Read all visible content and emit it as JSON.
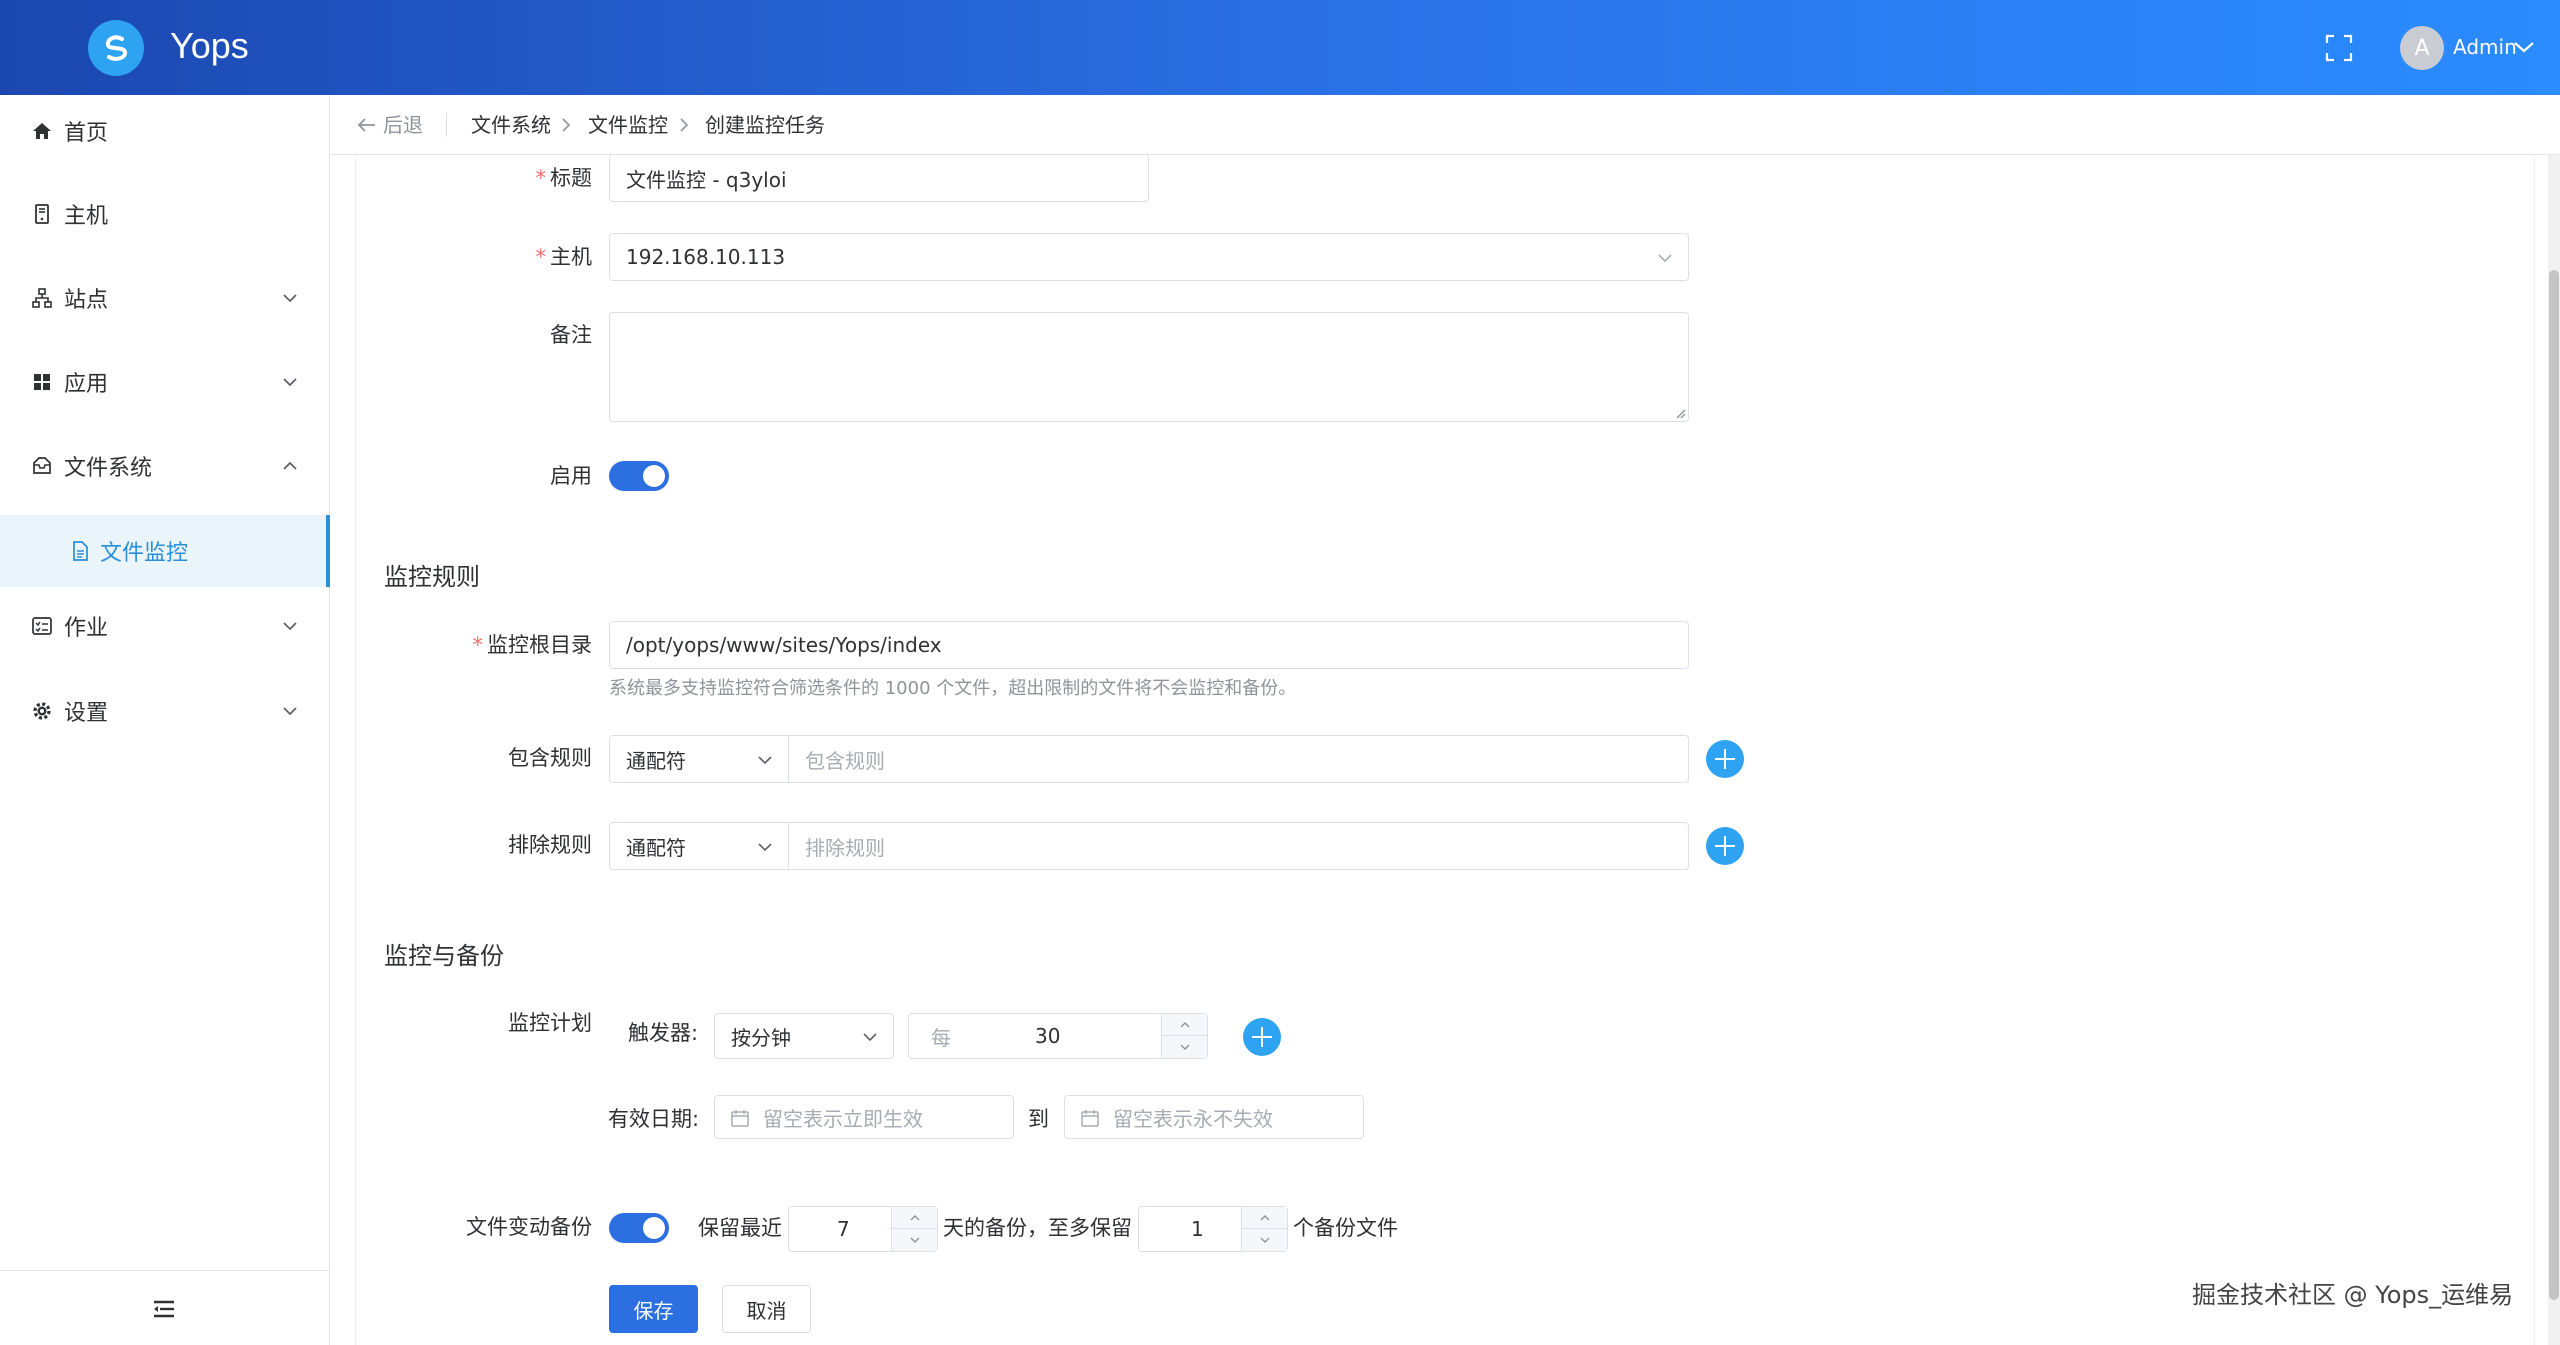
{
  "app": {
    "title": "Yops"
  },
  "header": {
    "username": "Admin",
    "avatar_letter": "A"
  },
  "sidebar": {
    "items": [
      {
        "label": "首页",
        "icon": "home-icon"
      },
      {
        "label": "主机",
        "icon": "server-icon"
      },
      {
        "label": "站点",
        "icon": "sitemap-icon"
      },
      {
        "label": "应用",
        "icon": "apps-icon"
      },
      {
        "label": "文件系统",
        "icon": "folder-lock-icon"
      },
      {
        "label": "文件监控",
        "icon": "file-icon"
      },
      {
        "label": "作业",
        "icon": "task-list-icon"
      },
      {
        "label": "设置",
        "icon": "gear-icon"
      }
    ]
  },
  "breadcrumb": {
    "back": "后退",
    "items": [
      "文件系统",
      "文件监控",
      "创建监控任务"
    ]
  },
  "form": {
    "title_label": "标题",
    "title_value": "文件监控 - q3yloi",
    "host_label": "主机",
    "host_value": "192.168.10.113",
    "remark_label": "备注",
    "enable_label": "启用",
    "rules_section": "监控规则",
    "root_label": "监控根目录",
    "root_value": "/opt/yops/www/sites/Yops/index",
    "root_hint": "系统最多支持监控符合筛选条件的 1000 个文件，超出限制的文件将不会监控和备份。",
    "include_label": "包含规则",
    "include_type": "通配符",
    "include_placeholder": "包含规则",
    "exclude_label": "排除规则",
    "exclude_type": "通配符",
    "exclude_placeholder": "排除规则",
    "backup_section": "监控与备份",
    "schedule_label": "监控计划",
    "trigger_label": "触发器:",
    "trigger_value": "按分钟",
    "every_prefix": "每",
    "every_value": "30",
    "valid_label": "有效日期:",
    "start_placeholder": "留空表示立即生效",
    "to_label": "到",
    "end_placeholder": "留空表示永不失效",
    "backup_label": "文件变动备份",
    "keep_recent_prefix": "保留最近",
    "keep_days": "7",
    "days_suffix": "天的备份，至多保留",
    "keep_count": "1",
    "count_suffix": "个备份文件",
    "save_button": "保存",
    "cancel_button": "取消"
  },
  "watermark": "掘金技术社区 @ Yops_运维易",
  "colors": {
    "primary": "#2b6fe0",
    "accent": "#2ea3f2",
    "header_start": "#1b47b0",
    "header_end": "#2a8cff",
    "required": "#f56c6c"
  }
}
